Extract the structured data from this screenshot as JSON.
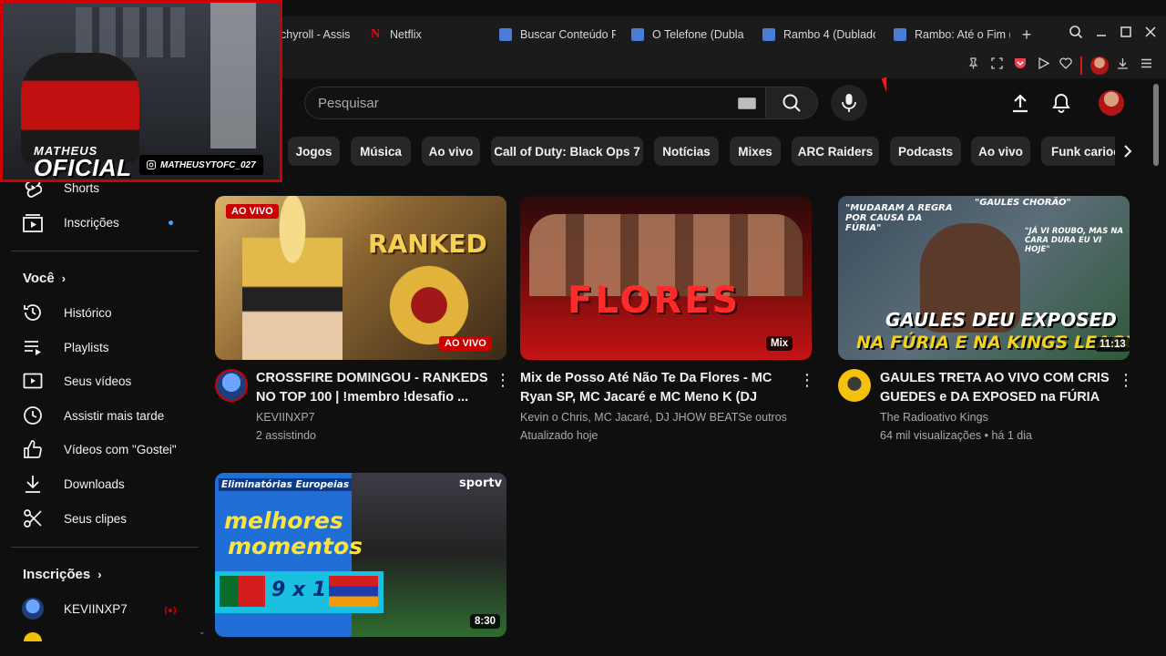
{
  "browser": {
    "tabs": [
      {
        "label": "chyroll - Assis",
        "icon": "crunchyroll-icon"
      },
      {
        "label": "Netflix",
        "icon": "netflix-icon"
      },
      {
        "label": "Buscar Conteúdo F",
        "icon": "doc-icon"
      },
      {
        "label": "O Telefone (Dublac",
        "icon": "doc-icon"
      },
      {
        "label": "Rambo 4 (Dublado",
        "icon": "doc-icon"
      },
      {
        "label": "Rambo: Até o Fim (",
        "icon": "doc-icon"
      }
    ],
    "new_tab": "+",
    "netflix_glyph": "N"
  },
  "header": {
    "search_placeholder": "Pesquisar"
  },
  "chips": [
    "Jogos",
    "Música",
    "Ao vivo",
    "Call of Duty: Black Ops 7",
    "Notícias",
    "Mixes",
    "ARC Raiders",
    "Podcasts",
    "Ao vivo",
    "Funk carioc"
  ],
  "sidebar": {
    "top_items": [
      {
        "label": "Shorts",
        "icon": "shorts-icon"
      },
      {
        "label": "Inscrições",
        "icon": "subscriptions-icon"
      }
    ],
    "you_heading": "Você",
    "you_items": [
      {
        "label": "Histórico",
        "icon": "history-icon"
      },
      {
        "label": "Playlists",
        "icon": "playlists-icon"
      },
      {
        "label": "Seus vídeos",
        "icon": "your-videos-icon"
      },
      {
        "label": "Assistir mais tarde",
        "icon": "watch-later-icon"
      },
      {
        "label": "Vídeos com \"Gostei\"",
        "icon": "liked-icon"
      },
      {
        "label": "Downloads",
        "icon": "download-icon"
      },
      {
        "label": "Seus clipes",
        "icon": "scissors-icon"
      }
    ],
    "subs_heading": "Inscrições",
    "subs_items": [
      {
        "label": "KEVIINXP7",
        "icon": "channel-avatar"
      }
    ]
  },
  "videos": [
    {
      "title": "CROSSFIRE DOMINGOU - RANKEDS NO TOP 100 | !membro !desafio ...",
      "channel": "KEVIINXP7",
      "meta": "2 assistindo",
      "badge_top": "AO VIVO",
      "badge_bottom": "AO VIVO",
      "thumb_text": "RANKED"
    },
    {
      "title": "Mix de Posso Até Não Te Da Flores - MC Ryan SP, MC Jacaré e MC Meno K (DJ Jap...",
      "channel": "Kevin o Chris, MC Jacaré, DJ JHOW BEATSe outros",
      "meta": "Atualizado hoje",
      "thumb_text": "FLORES",
      "badge_mix": "Mix"
    },
    {
      "title": "GAULES TRETA AO VIVO COM CRIS GUEDES e DA EXPOSED na FÚRIA e...",
      "channel": "The Radioativo Kings",
      "meta": "64 mil visualizações • há 1 dia",
      "duration": "11:13",
      "thumb_text_1": "GAULES DEU EXPOSED",
      "thumb_text_2": "NA FÚRIA E NA KINGS LEAGUE",
      "thumb_quote_1": "\"MUDARAM A REGRA POR CAUSA DA FÚRIA\"",
      "thumb_quote_2": "\"GAULES CHORÃO\"",
      "thumb_quote_3": "\"JÁ VI ROUBO, MAS NA CARA DURA EU VI HOJE\""
    },
    {
      "duration": "8:30",
      "thumb_tag": "Eliminatórias Europeias",
      "thumb_line_1": "melhores",
      "thumb_line_2": "momentos",
      "thumb_score": "9 x 1",
      "thumb_brand": "sportv"
    }
  ],
  "webcam": {
    "name": "MATHEUS",
    "title": "OFICIAL",
    "handle": "MATHEUSYTOFC_027"
  },
  "colors": {
    "background": "#0f0f0f",
    "chip": "#272727",
    "live_red": "#cc0000",
    "accent_blue": "#3ea6ff",
    "text_secondary": "#aaaaaa"
  }
}
